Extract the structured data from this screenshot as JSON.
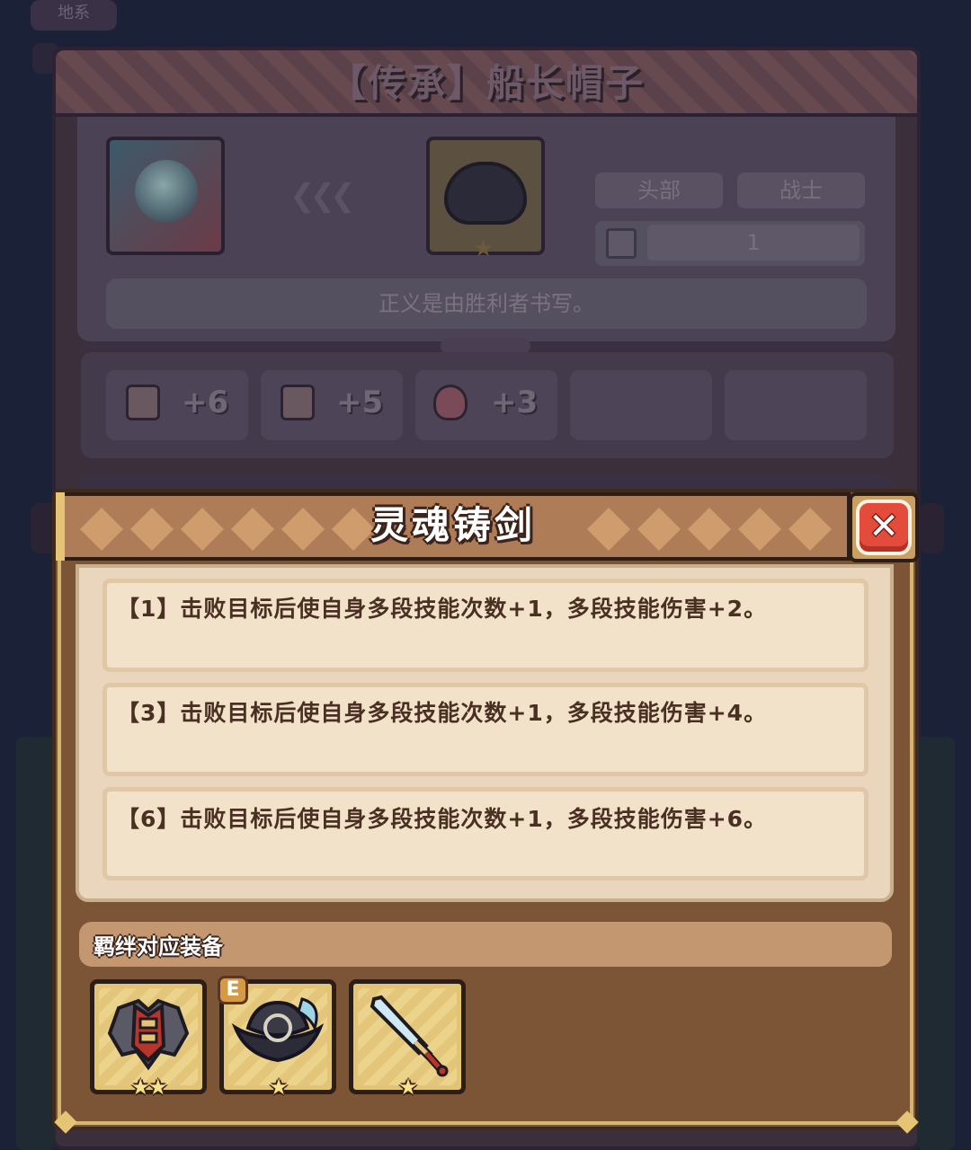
{
  "background": {
    "top_tag": "地系",
    "item_title": "【传承】船长帽子",
    "slot_label": "头部",
    "class_label": "战士",
    "level_value": "1",
    "quote": "正义是由胜利者书写。",
    "stats": [
      {
        "icon": "fist-icon",
        "value": "+6"
      },
      {
        "icon": "book-icon",
        "value": "+5"
      },
      {
        "icon": "heart-icon",
        "value": "+3"
      }
    ],
    "hat_stars": "★"
  },
  "dialog": {
    "title": "灵魂铸剑",
    "close_label": "✕",
    "effects": [
      "【1】击败目标后使自身多段技能次数+1，多段技能伤害+2。",
      "【3】击败目标后使自身多段技能次数+1，多段技能伤害+4。",
      "【6】击败目标后使自身多段技能次数+1，多段技能伤害+6。"
    ],
    "set_label": "羁绊对应装备",
    "equipment": [
      {
        "icon": "armor-icon",
        "stars": "★★"
      },
      {
        "icon": "captain-hat-icon",
        "stars": "★",
        "badge": "E"
      },
      {
        "icon": "sword-icon",
        "stars": "★"
      }
    ]
  },
  "colors": {
    "dialog_brown": "#7b5536",
    "header_tan": "#ae7c57",
    "close_red": "#e34b3a",
    "gold": "#e6c475",
    "parchment": "#e9d6bc"
  }
}
